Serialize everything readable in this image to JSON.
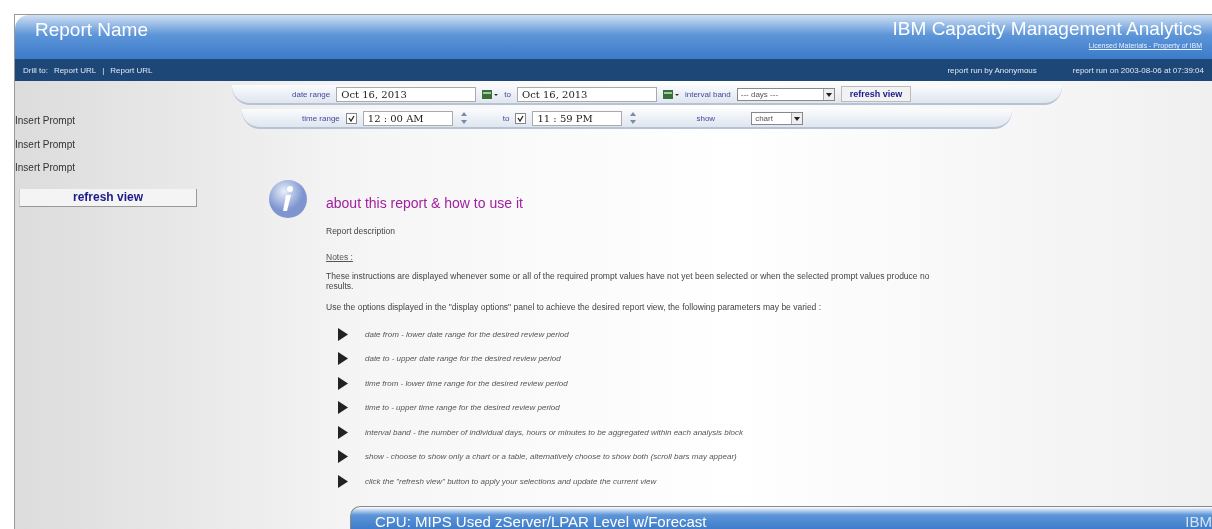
{
  "header": {
    "title": "Report Name",
    "product": "IBM Capacity Management Analytics",
    "license_link": "Licensed Materials - Property of IBM"
  },
  "nav": {
    "drill_label": "Drill to:",
    "links": [
      "Report URL",
      "Report URL"
    ],
    "separator": "|",
    "run_by": "report run by Anonymous",
    "run_on": "report run on 2003-08-06 at 07:39:04"
  },
  "prompts": {
    "date_label": "date range",
    "date_from": "Oct 16, 2013",
    "date_to_label": "to",
    "date_to": "Oct 16, 2013",
    "interval_label": "interval band",
    "interval_value": "--- days ---",
    "refresh": "refresh view",
    "time_label": "time range",
    "time_from_checked": true,
    "time_from": "12 : 00  AM",
    "time_to_label": "to",
    "time_to_checked": true,
    "time_to": "11 : 59  PM",
    "show_label": "show",
    "show_value": "chart"
  },
  "sidebar": {
    "prompts": [
      "Insert Prompt",
      "Insert Prompt",
      "Insert Prompt"
    ],
    "refresh": "refresh view"
  },
  "info": {
    "title": "about this report & how to use it",
    "description": "Report description",
    "notes_label": "Notes :",
    "paragraphs": [
      "These instructions are displayed whenever some or all of the required prompt values have not yet been selected or when the selected prompt values produce no results.",
      "Use the options displayed in the \"display options\" panel to achieve the desired report view, the following parameters may be varied :"
    ],
    "bullets": [
      "date from - lower date range for the desired review period",
      "date to - upper date range for the desired review period",
      "time from - lower time range for the desired review period",
      "time to - upper time range for the desired review period",
      "interval band - the number of individual days, hours or minutes to be aggregated within each analysis block",
      "show - choose to show only a chart or a table, alternatively choose to show both (scroll bars may appear)",
      "click the \"refresh view\" button to apply your selections and update the current view"
    ]
  },
  "overlay_window": {
    "title": "CPU: MIPS Used zServer/LPAR Level w/Forecast",
    "brand": "IBM"
  }
}
